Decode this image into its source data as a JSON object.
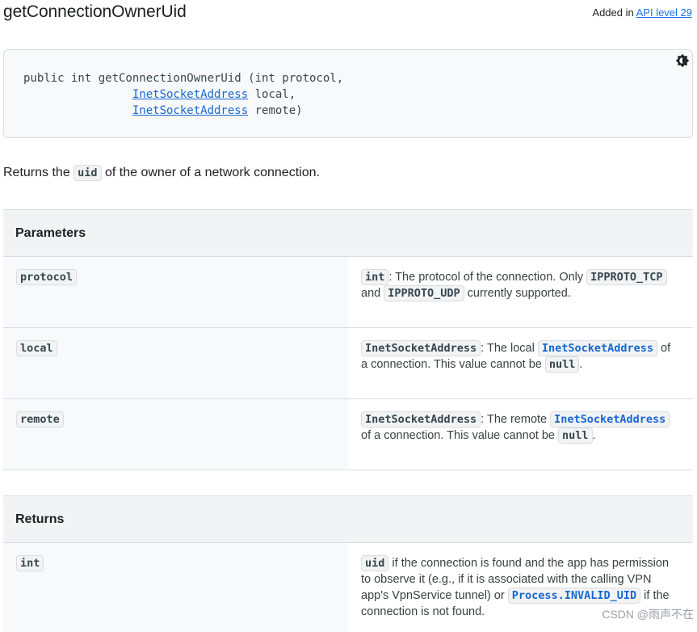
{
  "method": {
    "title": "getConnectionOwnerUid",
    "added_prefix": "Added in ",
    "added_link": "API level 29"
  },
  "signature": {
    "line1": "public int getConnectionOwnerUid (int protocol,",
    "indent": "                ",
    "type_local": "InetSocketAddress",
    "param_local": " local,",
    "type_remote": "InetSocketAddress",
    "param_remote": " remote)",
    "theme_toggle_icon": "brightness-toggle-icon"
  },
  "description": {
    "prefix": "Returns the ",
    "code": "uid",
    "suffix": " of the owner of a network connection."
  },
  "parameters": {
    "header": "Parameters",
    "rows": [
      {
        "name": "protocol",
        "type": "int",
        "t1": ": The protocol of the connection. Only ",
        "c1": "IPPROTO_TCP",
        "t2": " and ",
        "c2": "IPPROTO_UDP",
        "t3": " currently supported."
      },
      {
        "name": "local",
        "type": "InetSocketAddress",
        "t1": ": The local ",
        "c1": "InetSocketAddress",
        "t2": " of a connection. This value cannot be ",
        "c2": "null",
        "t3": "."
      },
      {
        "name": "remote",
        "type": "InetSocketAddress",
        "t1": ": The remote ",
        "c1": "InetSocketAddress",
        "t2": " of a connection. This value cannot be ",
        "c2": "null",
        "t3": "."
      }
    ]
  },
  "returns": {
    "header": "Returns",
    "type": "int",
    "c1": "uid",
    "t1": " if the connection is found and the app has permission to observe it (e.g., if it is associated with the calling VPN app's VpnService tunnel) or ",
    "c2": "Process.INVALID_UID",
    "t2": " if the connection is not found."
  },
  "watermark": "CSDN @雨声不在"
}
